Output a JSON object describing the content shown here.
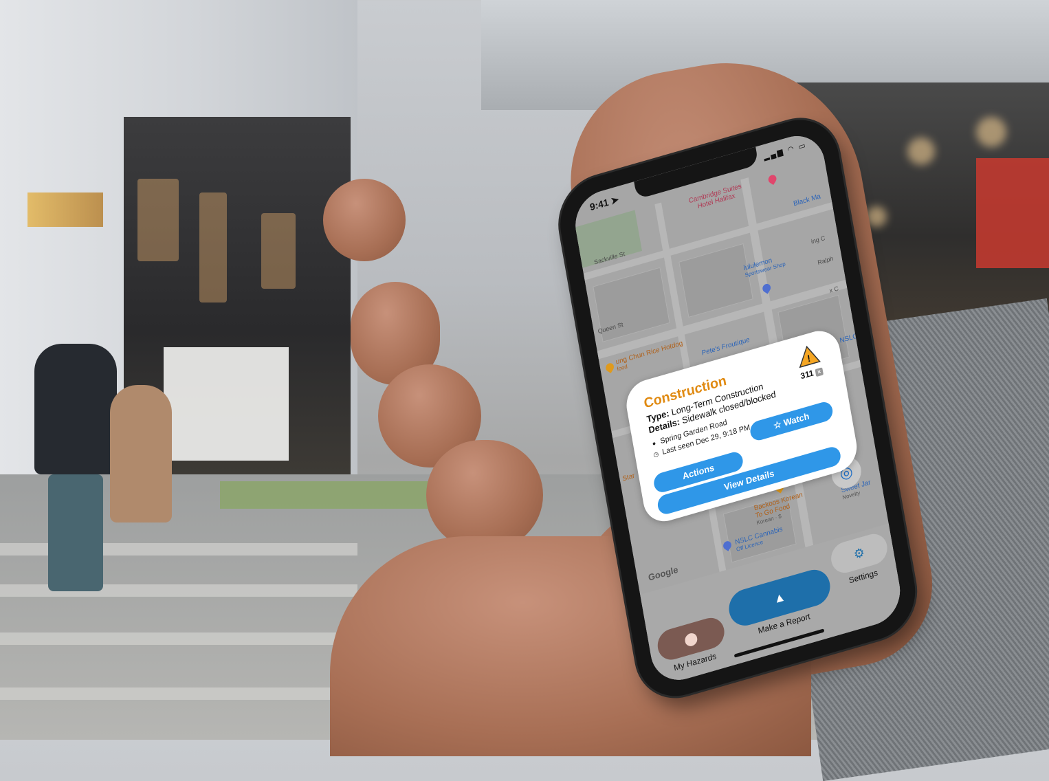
{
  "app": {
    "status": {
      "time": "9:41"
    },
    "map": {
      "labels": {
        "hotel": "Cambridge Suites\nHotel Halifax",
        "hotel_line1": "Cambridge Suites",
        "hotel_line2": "Hotel Halifax",
        "black_ma": "Black Ma",
        "sackville": "Sackville St",
        "queen": "Queen St",
        "lululemon": "lululemon",
        "lululemon_sub": "Sportswear Shop",
        "ing_c": "ing C",
        "ralph": "Ralph",
        "hotdog": "ung Chun Rice Hotdog",
        "hotdog_sub": "food",
        "froutique": "Pete's Froutique",
        "xc": "x C",
        "nslc_right": "NSLC",
        "star": "Star",
        "backoos": "Backoos Korean\nTo Go Food",
        "backoos_line1": "Backoos Korean",
        "backoos_line2": "To Go Food",
        "backoos_sub": "Korean · $",
        "sweet_jar": "Sweet Jar",
        "sweet_jar_sub": "Novelty",
        "nslc": "NSLC Cannabis",
        "nslc_sub": "Off Licence",
        "google": "Google"
      }
    },
    "popup": {
      "title": "Construction",
      "type_label": "Type:",
      "type_value": "Long-Term Construction",
      "details_label": "Details:",
      "details_value": "Sidewalk closed/blocked",
      "location": "Spring Garden Road",
      "last_seen": "Last seen Dec 29, 9:18 PM",
      "count": "311",
      "count_close": "×",
      "watch_label": "Watch",
      "watch_icon": "☆",
      "actions_label": "Actions",
      "view_details_label": "View Details"
    },
    "tabs": {
      "my_hazards": "My Hazards",
      "make_report": "Make a Report",
      "settings": "Settings"
    },
    "colors": {
      "accent": "#2f97e8",
      "title_orange": "#e08a12",
      "report_pill": "#1e6faa",
      "hazards_pill": "#7b5a52",
      "settings_pill": "#bdbdbd"
    }
  }
}
